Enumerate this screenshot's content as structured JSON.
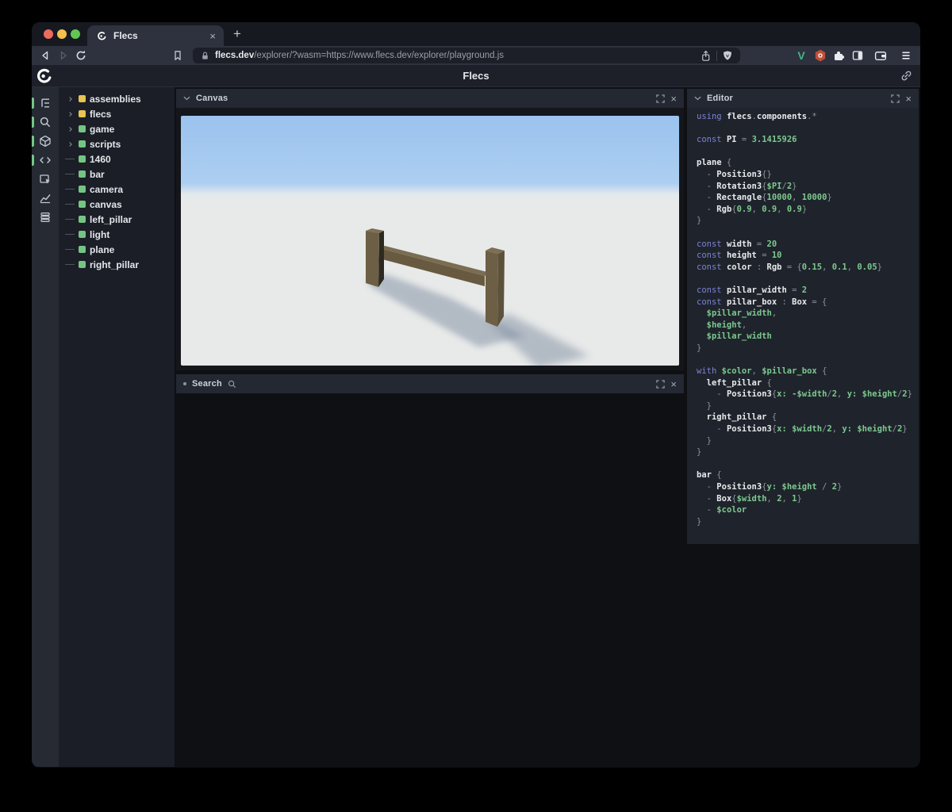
{
  "browser": {
    "tab_title": "Flecs",
    "url_domain": "flecs.dev",
    "url_path": "/explorer/?wasm=https://www.flecs.dev/explorer/playground.js"
  },
  "header": {
    "title": "Flecs"
  },
  "icons": {
    "close": "×",
    "new_tab": "+",
    "vue_badge": "V"
  },
  "sidebar": {
    "tools": [
      {
        "name": "entity-tree",
        "active": true
      },
      {
        "name": "query-search",
        "active": true
      },
      {
        "name": "canvas-3d",
        "active": true
      },
      {
        "name": "script-editor",
        "active": true
      },
      {
        "name": "inspector",
        "active": false
      },
      {
        "name": "statistics",
        "active": false
      },
      {
        "name": "tables",
        "active": false
      }
    ],
    "active_color": "#74c787"
  },
  "tree": {
    "items": [
      {
        "label": "assemblies",
        "expandable": true,
        "dot": "yellow"
      },
      {
        "label": "flecs",
        "expandable": true,
        "dot": "yellow"
      },
      {
        "label": "game",
        "expandable": true,
        "dot": "green"
      },
      {
        "label": "scripts",
        "expandable": true,
        "dot": "green"
      },
      {
        "label": "1460",
        "expandable": false,
        "dot": "green"
      },
      {
        "label": "bar",
        "expandable": false,
        "dot": "green"
      },
      {
        "label": "camera",
        "expandable": false,
        "dot": "green"
      },
      {
        "label": "canvas",
        "expandable": false,
        "dot": "green"
      },
      {
        "label": "left_pillar",
        "expandable": false,
        "dot": "green"
      },
      {
        "label": "light",
        "expandable": false,
        "dot": "green"
      },
      {
        "label": "plane",
        "expandable": false,
        "dot": "green"
      },
      {
        "label": "right_pillar",
        "expandable": false,
        "dot": "green"
      }
    ],
    "dot_colors": {
      "yellow": "#e7c453",
      "green": "#74c584"
    }
  },
  "panels": {
    "canvas": {
      "title": "Canvas"
    },
    "search": {
      "title": "Search"
    },
    "editor": {
      "title": "Editor"
    }
  },
  "editor": {
    "code": [
      [
        [
          "k",
          "using "
        ],
        [
          "i",
          "flecs"
        ],
        [
          "p",
          "."
        ],
        [
          "i",
          "components"
        ],
        [
          "p",
          ".*"
        ]
      ],
      [],
      [
        [
          "k",
          "const "
        ],
        [
          "i",
          "PI"
        ],
        [
          "p",
          " = "
        ],
        [
          "n",
          "3.1415926"
        ]
      ],
      [],
      [
        [
          "i",
          "plane"
        ],
        [
          "p",
          " {"
        ]
      ],
      [
        [
          "p",
          "  - "
        ],
        [
          "i",
          "Position3"
        ],
        [
          "p",
          "{}"
        ]
      ],
      [
        [
          "p",
          "  - "
        ],
        [
          "i",
          "Rotation3"
        ],
        [
          "p",
          "{"
        ],
        [
          "v",
          "$PI"
        ],
        [
          "p",
          "/"
        ],
        [
          "n",
          "2"
        ],
        [
          "p",
          "}"
        ]
      ],
      [
        [
          "p",
          "  - "
        ],
        [
          "i",
          "Rectangle"
        ],
        [
          "p",
          "{"
        ],
        [
          "n",
          "10000"
        ],
        [
          "p",
          ", "
        ],
        [
          "n",
          "10000"
        ],
        [
          "p",
          "}"
        ]
      ],
      [
        [
          "p",
          "  - "
        ],
        [
          "i",
          "Rgb"
        ],
        [
          "p",
          "{"
        ],
        [
          "n",
          "0.9"
        ],
        [
          "p",
          ", "
        ],
        [
          "n",
          "0.9"
        ],
        [
          "p",
          ", "
        ],
        [
          "n",
          "0.9"
        ],
        [
          "p",
          "}"
        ]
      ],
      [
        [
          "p",
          "}"
        ]
      ],
      [],
      [
        [
          "k",
          "const "
        ],
        [
          "i",
          "width"
        ],
        [
          "p",
          " = "
        ],
        [
          "n",
          "20"
        ]
      ],
      [
        [
          "k",
          "const "
        ],
        [
          "i",
          "height"
        ],
        [
          "p",
          " = "
        ],
        [
          "n",
          "10"
        ]
      ],
      [
        [
          "k",
          "const "
        ],
        [
          "i",
          "color"
        ],
        [
          "p",
          " : "
        ],
        [
          "i",
          "Rgb"
        ],
        [
          "p",
          " = {"
        ],
        [
          "n",
          "0.15"
        ],
        [
          "p",
          ", "
        ],
        [
          "n",
          "0.1"
        ],
        [
          "p",
          ", "
        ],
        [
          "n",
          "0.05"
        ],
        [
          "p",
          "}"
        ]
      ],
      [],
      [
        [
          "k",
          "const "
        ],
        [
          "i",
          "pillar_width"
        ],
        [
          "p",
          " = "
        ],
        [
          "n",
          "2"
        ]
      ],
      [
        [
          "k",
          "const "
        ],
        [
          "i",
          "pillar_box"
        ],
        [
          "p",
          " : "
        ],
        [
          "i",
          "Box"
        ],
        [
          "p",
          " = {"
        ]
      ],
      [
        [
          "v",
          "  $pillar_width"
        ],
        [
          "p",
          ","
        ]
      ],
      [
        [
          "v",
          "  $height"
        ],
        [
          "p",
          ","
        ]
      ],
      [
        [
          "v",
          "  $pillar_width"
        ]
      ],
      [
        [
          "p",
          "}"
        ]
      ],
      [],
      [
        [
          "k",
          "with "
        ],
        [
          "v",
          "$color"
        ],
        [
          "p",
          ", "
        ],
        [
          "v",
          "$pillar_box"
        ],
        [
          "p",
          " {"
        ]
      ],
      [
        [
          "i",
          "  left_pillar"
        ],
        [
          "p",
          " {"
        ]
      ],
      [
        [
          "p",
          "    - "
        ],
        [
          "i",
          "Position3"
        ],
        [
          "p",
          "{"
        ],
        [
          "v",
          "x: -$width"
        ],
        [
          "p",
          "/"
        ],
        [
          "n",
          "2"
        ],
        [
          "p",
          ", "
        ],
        [
          "v",
          "y: $height"
        ],
        [
          "p",
          "/"
        ],
        [
          "n",
          "2"
        ],
        [
          "p",
          "}"
        ]
      ],
      [
        [
          "p",
          "  }"
        ]
      ],
      [
        [
          "i",
          "  right_pillar"
        ],
        [
          "p",
          " {"
        ]
      ],
      [
        [
          "p",
          "    - "
        ],
        [
          "i",
          "Position3"
        ],
        [
          "p",
          "{"
        ],
        [
          "v",
          "x: $width"
        ],
        [
          "p",
          "/"
        ],
        [
          "n",
          "2"
        ],
        [
          "p",
          ", "
        ],
        [
          "v",
          "y: $height"
        ],
        [
          "p",
          "/"
        ],
        [
          "n",
          "2"
        ],
        [
          "p",
          "}"
        ]
      ],
      [
        [
          "p",
          "  }"
        ]
      ],
      [
        [
          "p",
          "}"
        ]
      ],
      [],
      [
        [
          "i",
          "bar"
        ],
        [
          "p",
          " {"
        ]
      ],
      [
        [
          "p",
          "  - "
        ],
        [
          "i",
          "Position3"
        ],
        [
          "p",
          "{"
        ],
        [
          "v",
          "y: $height"
        ],
        [
          "p",
          " / "
        ],
        [
          "n",
          "2"
        ],
        [
          "p",
          "}"
        ]
      ],
      [
        [
          "p",
          "  - "
        ],
        [
          "i",
          "Box"
        ],
        [
          "p",
          "{"
        ],
        [
          "v",
          "$width"
        ],
        [
          "p",
          ", "
        ],
        [
          "n",
          "2"
        ],
        [
          "p",
          ", "
        ],
        [
          "n",
          "1"
        ],
        [
          "p",
          "}"
        ]
      ],
      [
        [
          "p",
          "  - "
        ],
        [
          "v",
          "$color"
        ]
      ],
      [
        [
          "p",
          "}"
        ]
      ]
    ]
  },
  "scene": {
    "colors": {
      "sky_top": "#9bc3ee",
      "sky_low": "#accef1",
      "horizon": "#e4e9ec",
      "ground": "#e8eae9",
      "pillar_front": "#6d5f45",
      "pillar_side_dark": "#2c2a20",
      "pillar_side": "#5c523c",
      "pillar_top": "#7c6f54",
      "bar_front": "#685a41",
      "bar_top": "#7a6d52",
      "shadow": "#7e8ca0"
    }
  }
}
